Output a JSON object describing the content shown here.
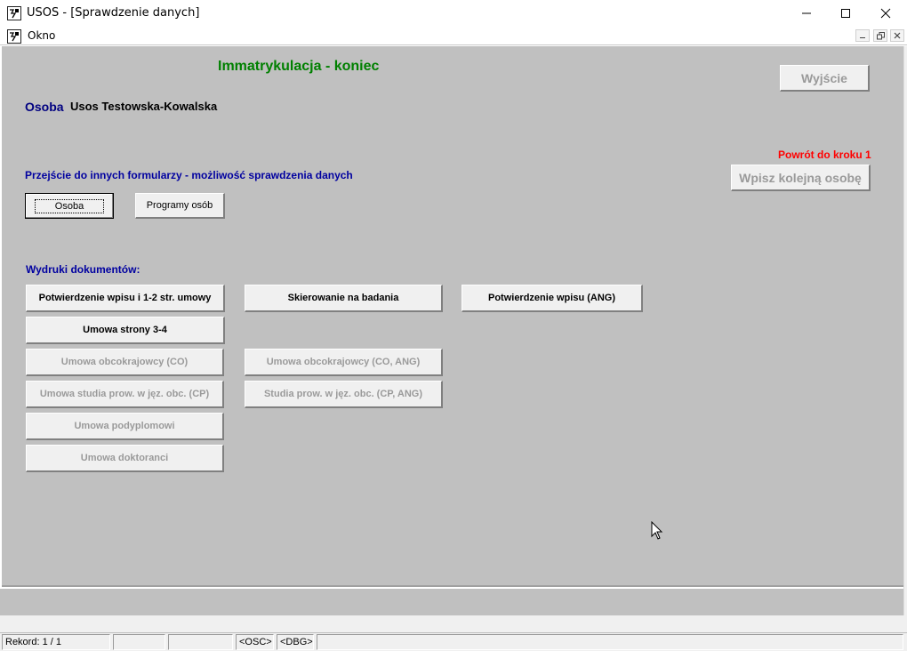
{
  "window": {
    "title": "USOS - [Sprawdzenie danych]",
    "menu_label": "Okno"
  },
  "form": {
    "heading": "Immatrykulacja - koniec",
    "person_label": "Osoba",
    "person_name": "Usos Testowska-Kowalska",
    "exit_button": "Wyjście",
    "return_label": "Powrót do kroku 1",
    "next_person_button": "Wpisz kolejną osobę",
    "navigation_section": "Przejście do innych formularzy - możliwość sprawdzenia danych",
    "nav_buttons": {
      "osoba": "Osoba",
      "programy": "Programy osób"
    },
    "prints_section": "Wydruki dokumentów:",
    "print_buttons": {
      "confirmation": "Potwierdzenie wpisu i 1-2 str. umowy",
      "referral": "Skierowanie na badania",
      "confirmation_eng": "Potwierdzenie wpisu (ANG)",
      "contract_3_4": "Umowa strony 3-4",
      "foreigners": "Umowa obcokrajowcy (CO)",
      "foreigners_eng": "Umowa obcokrajowcy (CO, ANG)",
      "foreign_lang": "Umowa studia prow. w jęz. obc. (CP)",
      "foreign_lang_eng": "Studia prow. w jęz. obc. (CP, ANG)",
      "postgraduate": "Umowa podyplomowi",
      "doctoral": "Umowa doktoranci"
    }
  },
  "status_bar": {
    "record": "Rekord: 1 / 1",
    "osc": "<OSC>",
    "dbg": "<DBG>"
  }
}
